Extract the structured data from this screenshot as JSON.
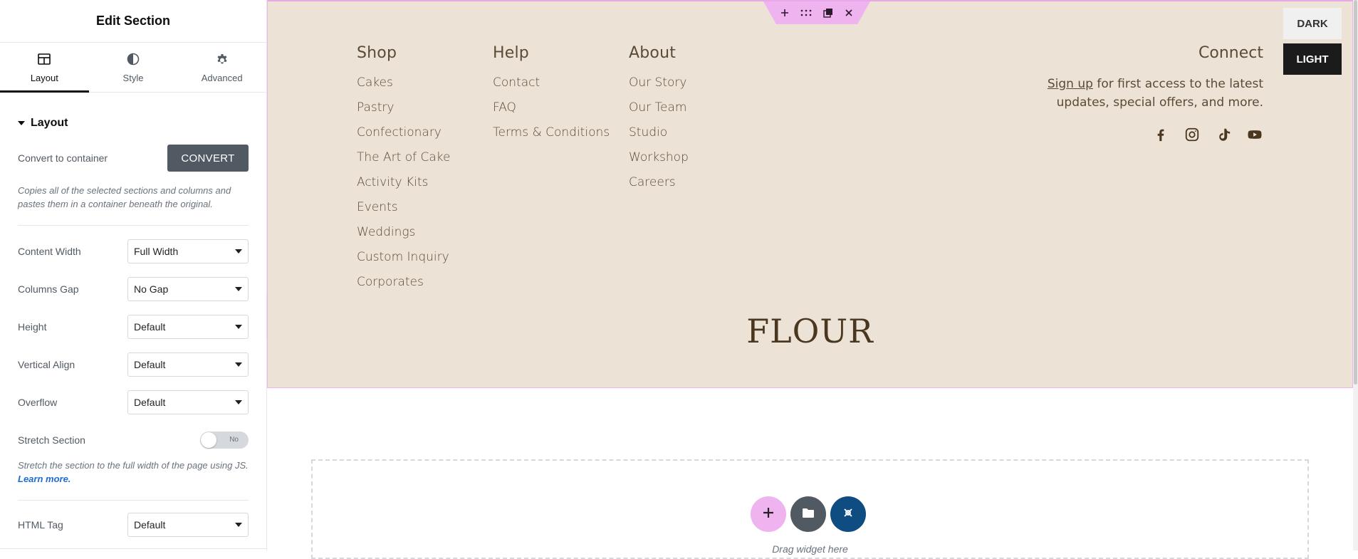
{
  "panel": {
    "title": "Edit Section",
    "tabs": [
      {
        "label": "Layout",
        "icon": "layout-icon"
      },
      {
        "label": "Style",
        "icon": "contrast-icon"
      },
      {
        "label": "Advanced",
        "icon": "gear-icon"
      }
    ],
    "section_title": "Layout",
    "convert": {
      "label": "Convert to container",
      "button": "CONVERT",
      "hint": "Copies all of the selected sections and columns and pastes them in a container beneath the original."
    },
    "fields": {
      "content_width": {
        "label": "Content Width",
        "value": "Full Width"
      },
      "columns_gap": {
        "label": "Columns Gap",
        "value": "No Gap"
      },
      "height": {
        "label": "Height",
        "value": "Default"
      },
      "vertical_align": {
        "label": "Vertical Align",
        "value": "Default"
      },
      "overflow": {
        "label": "Overflow",
        "value": "Default"
      },
      "stretch": {
        "label": "Stretch Section",
        "toggle": "No",
        "hint": "Stretch the section to the full width of the page using JS.",
        "link": "Learn more."
      },
      "html_tag": {
        "label": "HTML Tag",
        "value": "Default"
      }
    }
  },
  "footer": {
    "columns": [
      {
        "title": "Shop",
        "links": [
          "Cakes",
          "Pastry",
          "Confectionary",
          "The Art of Cake",
          "Activity Kits",
          "Events",
          "Weddings",
          "Custom Inquiry",
          "Corporates"
        ]
      },
      {
        "title": "Help",
        "links": [
          "Contact",
          "FAQ",
          "Terms & Conditions"
        ]
      },
      {
        "title": "About",
        "links": [
          "Our Story",
          "Our Team",
          "Studio",
          "Workshop",
          "Careers"
        ]
      }
    ],
    "connect": {
      "title": "Connect",
      "signup_link": "Sign up",
      "text": " for first access to the latest updates, special offers, and more.",
      "socials": [
        "facebook-icon",
        "instagram-icon",
        "tiktok-icon",
        "youtube-icon"
      ]
    },
    "logo": "FLOUR"
  },
  "mode": {
    "dark": "DARK",
    "light": "LIGHT"
  },
  "drop": {
    "text": "Drag widget here"
  },
  "colors": {
    "accent": "#efb3ef",
    "footer_bg": "#ece3d6",
    "button_dark": "#515962",
    "blue": "#0f4c81"
  }
}
